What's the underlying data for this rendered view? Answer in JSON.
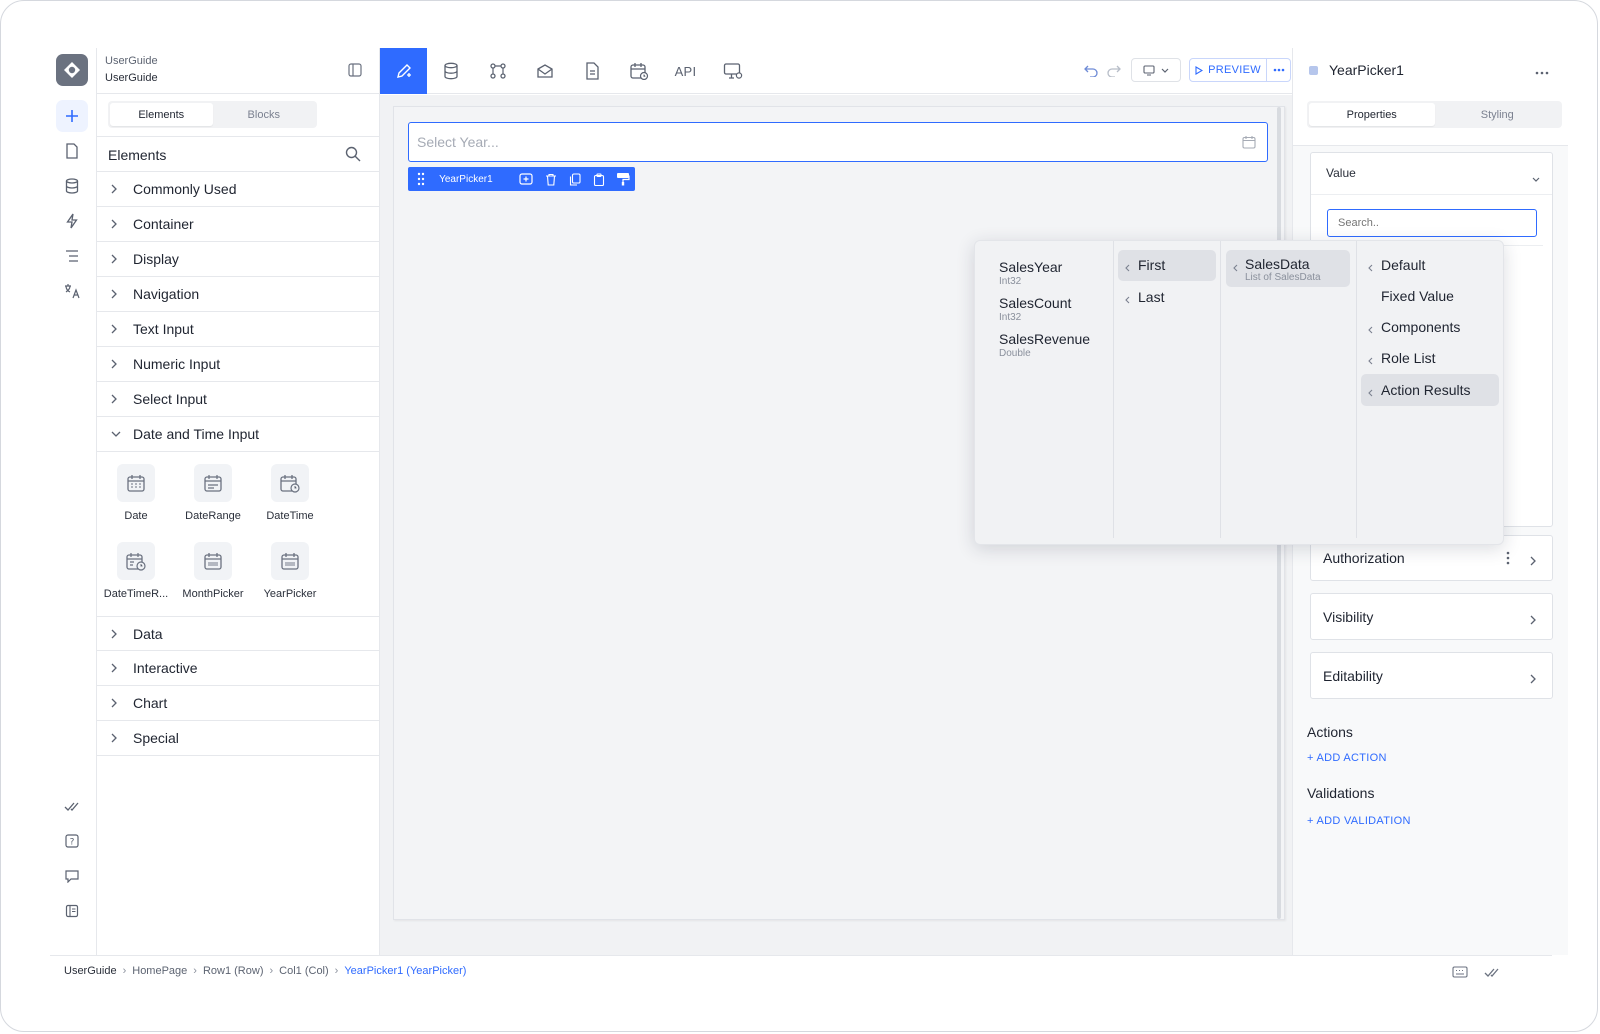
{
  "project": {
    "line1": "UserGuide",
    "line2": "UserGuide"
  },
  "sidebar": {
    "tabs": [
      "Elements",
      "Blocks"
    ],
    "search_label": "Elements",
    "categories_top": [
      "Commonly Used",
      "Container",
      "Display",
      "Navigation",
      "Text Input",
      "Numeric Input",
      "Select Input"
    ],
    "expanded": "Date and Time Input",
    "tiles": [
      "Date",
      "DateRange",
      "DateTime",
      "DateTimeR...",
      "MonthPicker",
      "YearPicker"
    ],
    "categories_bottom": [
      "Data",
      "Interactive",
      "Chart",
      "Special"
    ]
  },
  "toolbar": {
    "api_label": "API",
    "preview_label": "PREVIEW"
  },
  "canvas": {
    "placeholder": "Select Year...",
    "component_name": "YearPicker1"
  },
  "dropdown": {
    "fields": [
      {
        "name": "SalesYear",
        "type": "Int32"
      },
      {
        "name": "SalesCount",
        "type": "Int32"
      },
      {
        "name": "SalesRevenue",
        "type": "Double"
      }
    ],
    "pick": [
      "First",
      "Last"
    ],
    "source": {
      "name": "SalesData",
      "type": "List of SalesData"
    },
    "root": [
      "Default",
      "Fixed Value",
      "Components",
      "Role List",
      "Action Results"
    ]
  },
  "panel": {
    "title": "YearPicker1",
    "tabs": [
      "Properties",
      "Styling"
    ],
    "value_label": "Value",
    "search_placeholder": "Search..",
    "cards": [
      "Authorization",
      "Visibility",
      "Editability"
    ],
    "actions_title": "Actions",
    "add_action": "+ ADD ACTION",
    "validations_title": "Validations",
    "add_validation": "+ ADD VALIDATION"
  },
  "breadcrumb": {
    "items": [
      "UserGuide",
      "HomePage",
      "Row1 (Row)",
      "Col1 (Col)",
      "YearPicker1 (YearPicker)"
    ]
  },
  "colors": {
    "accent": "#2f6bff",
    "canvas": "#f1f2f4",
    "border": "#e6e8ec"
  }
}
